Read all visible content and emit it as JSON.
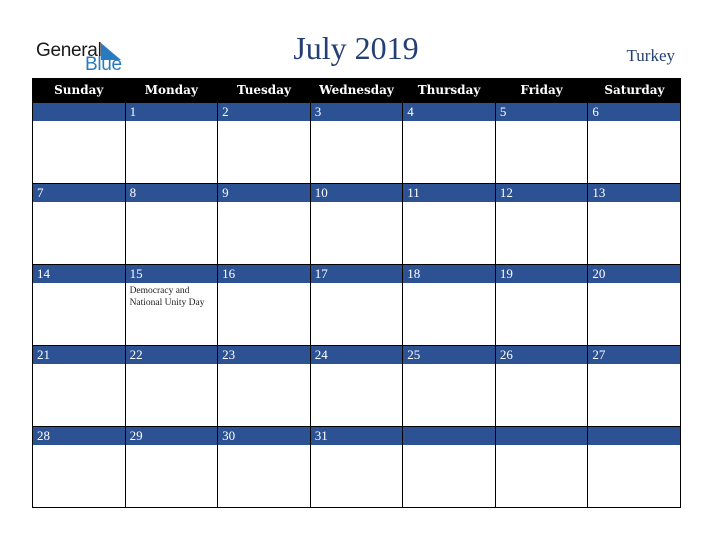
{
  "logo": {
    "line1": "General",
    "line2": "Blue"
  },
  "header": {
    "title": "July 2019",
    "country": "Turkey"
  },
  "weekdays": [
    "Sunday",
    "Monday",
    "Tuesday",
    "Wednesday",
    "Thursday",
    "Friday",
    "Saturday"
  ],
  "weeks": [
    [
      "",
      "1",
      "2",
      "3",
      "4",
      "5",
      "6"
    ],
    [
      "7",
      "8",
      "9",
      "10",
      "11",
      "12",
      "13"
    ],
    [
      "14",
      "15",
      "16",
      "17",
      "18",
      "19",
      "20"
    ],
    [
      "21",
      "22",
      "23",
      "24",
      "25",
      "26",
      "27"
    ],
    [
      "28",
      "29",
      "30",
      "31",
      "",
      "",
      ""
    ]
  ],
  "events": [
    {
      "week": 2,
      "day": 1,
      "label": "Democracy and National Unity Day"
    }
  ],
  "colors": {
    "header_bg": "#000000",
    "daynum_bg": "#2c5294",
    "title": "#243f73",
    "logo_blue": "#2a7ac0"
  }
}
